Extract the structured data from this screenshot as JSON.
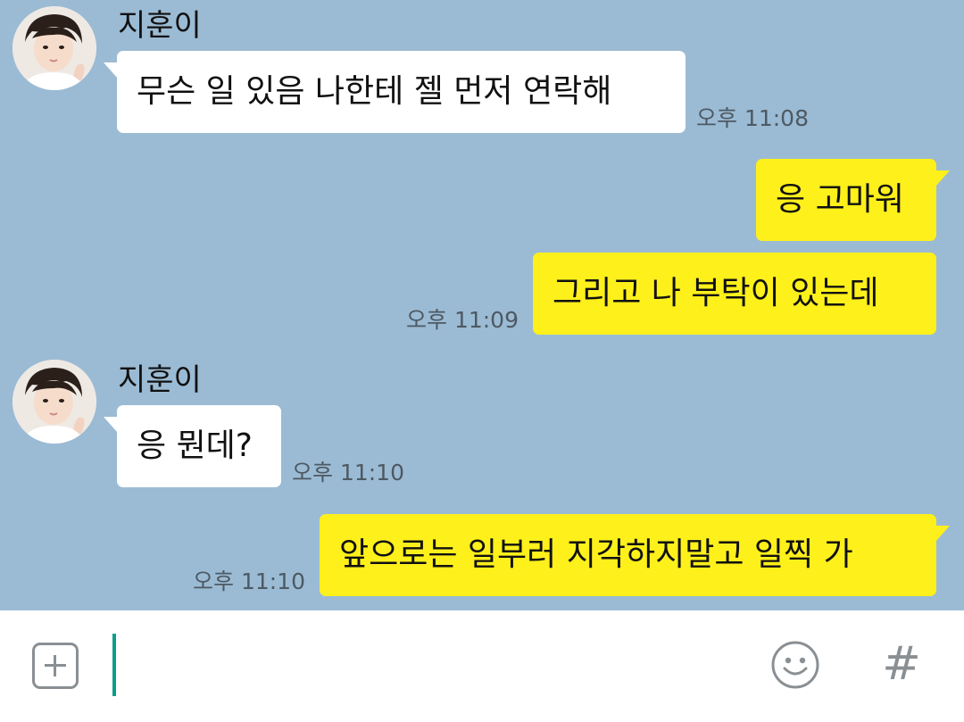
{
  "messages": [
    {
      "sender": "지훈이",
      "text": "무슨 일 있음 나한테 젤 먼저 연락해",
      "time": "오후 11:08"
    },
    {
      "text": "응 고마워"
    },
    {
      "text": "그리고 나 부탁이 있는데",
      "time": "오후 11:09"
    },
    {
      "sender": "지훈이",
      "text": "응 뭔데?",
      "time": "오후 11:10"
    },
    {
      "text": "앞으로는 일부러 지각하지말고 일찍 가",
      "time": "오후 11:10"
    }
  ],
  "input": {
    "placeholder": ""
  },
  "icons": {
    "attach": "plus-square-icon",
    "emoticon": "smiley-icon",
    "hashtag": "hash-icon"
  },
  "colors": {
    "chat_background": "#9bbbd4",
    "incoming_bubble": "#ffffff",
    "outgoing_bubble": "#fef01b",
    "cursor": "#0a9e8a"
  }
}
